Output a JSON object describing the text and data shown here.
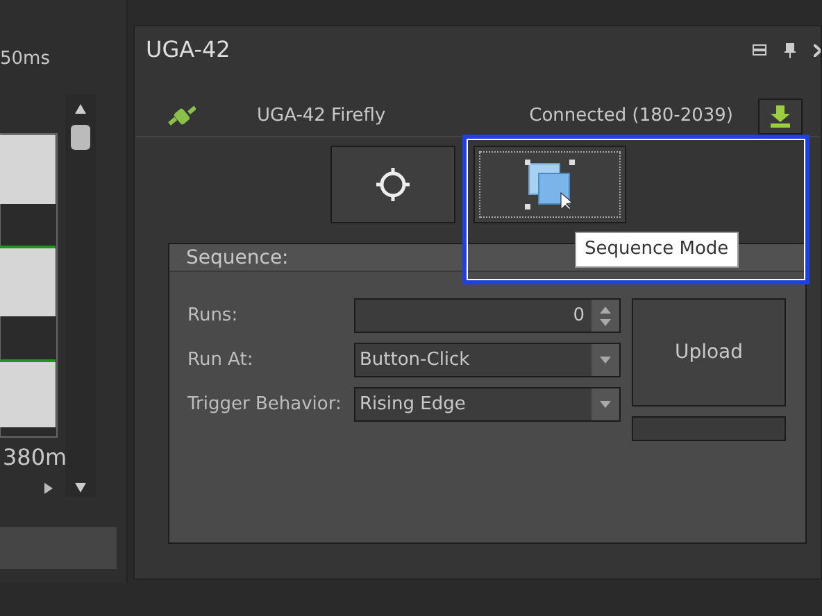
{
  "left_panel": {
    "time_top": "50ms",
    "time_bottom": "380m"
  },
  "device_panel": {
    "title": "UGA-42",
    "device_name": "UGA-42 Firefly",
    "status": "Connected (180-2039)",
    "tool_buttons": [
      {
        "kind": "locate",
        "focused": false
      },
      {
        "kind": "sequence",
        "focused": true
      }
    ],
    "tooltip": "Sequence Mode",
    "sequence": {
      "title": "Sequence:",
      "fields": [
        {
          "label": "Runs:",
          "kind": "spinner",
          "value": "0"
        },
        {
          "label": "Run At:",
          "kind": "dropdown",
          "value": "Button-Click"
        },
        {
          "label": "Trigger Behavior:",
          "kind": "dropdown",
          "value": "Rising Edge"
        }
      ],
      "upload": "Upload",
      "progress": {
        "level": 0
      }
    }
  }
}
